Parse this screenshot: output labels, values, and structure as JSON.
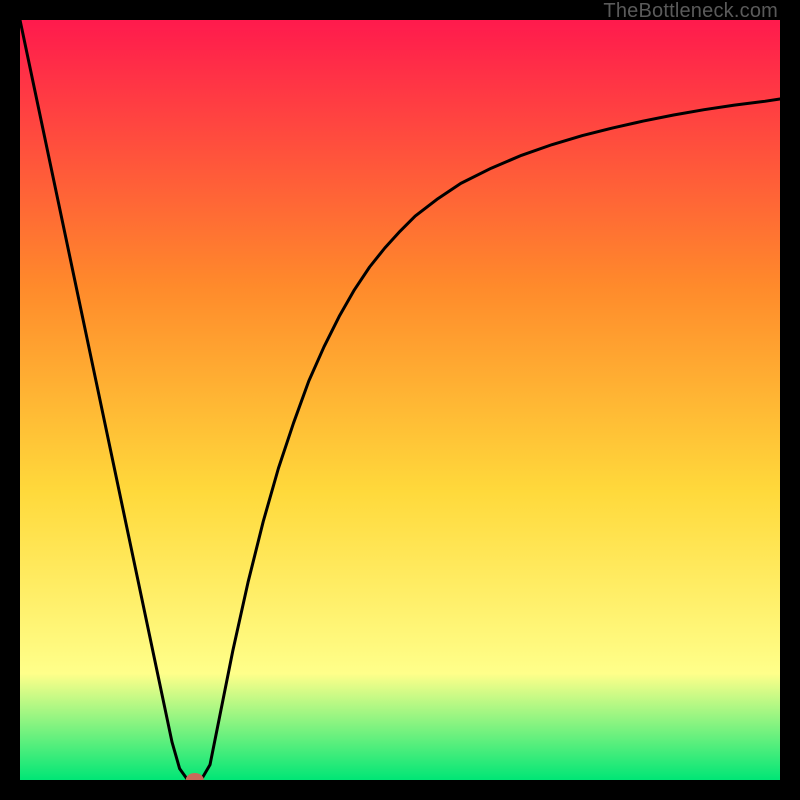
{
  "watermark": "TheBottleneck.com",
  "colors": {
    "frame": "#000000",
    "curve": "#000000",
    "marker": "#c86a5a",
    "gradient_top": "#ff1a4d",
    "gradient_mid_upper": "#ff8a2b",
    "gradient_mid": "#ffd93b",
    "gradient_mid_lower": "#ffff8a",
    "gradient_bottom": "#00e676"
  },
  "chart_data": {
    "type": "line",
    "title": "",
    "xlabel": "",
    "ylabel": "",
    "xlim": [
      0,
      100
    ],
    "ylim": [
      0,
      100
    ],
    "x": [
      0,
      2,
      4,
      6,
      8,
      10,
      12,
      14,
      16,
      18,
      20,
      21,
      22,
      23,
      24,
      25,
      26,
      28,
      30,
      32,
      34,
      36,
      38,
      40,
      42,
      44,
      46,
      48,
      50,
      52,
      55,
      58,
      62,
      66,
      70,
      74,
      78,
      82,
      86,
      90,
      94,
      98,
      100
    ],
    "values": [
      100,
      90.5,
      81,
      71.5,
      62,
      52.5,
      43,
      33.5,
      24,
      14.5,
      5,
      1.5,
      0.1,
      0,
      0.3,
      2,
      7,
      17,
      26,
      34,
      41,
      47,
      52.5,
      57,
      61,
      64.5,
      67.5,
      70,
      72.2,
      74.2,
      76.5,
      78.5,
      80.5,
      82.2,
      83.6,
      84.8,
      85.8,
      86.7,
      87.5,
      88.2,
      88.8,
      89.3,
      89.6
    ],
    "marker": {
      "x": 23,
      "y": 0
    }
  }
}
